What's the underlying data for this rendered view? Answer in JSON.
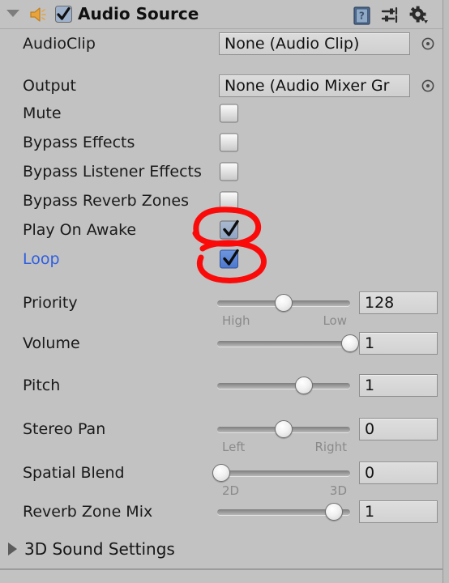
{
  "header": {
    "title": "Audio Source",
    "enabled_checkbox": true,
    "foldout_expanded": true,
    "icons": [
      {
        "name": "component-icon",
        "glyph": "speaker-icon"
      },
      {
        "name": "help-button",
        "glyph": "help-book-icon"
      },
      {
        "name": "preset-button",
        "glyph": "preset-sliders-icon"
      },
      {
        "name": "context-menu-button",
        "glyph": "gear-icon"
      }
    ]
  },
  "fields": {
    "audioclip": {
      "label": "AudioClip",
      "value": "None (Audio Clip)",
      "type": "object"
    },
    "output": {
      "label": "Output",
      "value": "None (Audio Mixer Gr",
      "type": "object"
    },
    "mute": {
      "label": "Mute",
      "checked": false
    },
    "bypass_effects": {
      "label": "Bypass Effects",
      "checked": false
    },
    "bypass_listener_effects": {
      "label": "Bypass Listener Effects",
      "checked": false
    },
    "bypass_reverb_zones": {
      "label": "Bypass Reverb Zones",
      "checked": false
    },
    "play_on_awake": {
      "label": "Play On Awake",
      "checked": true,
      "annotated": true
    },
    "loop": {
      "label": "Loop",
      "checked": true,
      "annotated": true,
      "highlighted": true
    },
    "priority": {
      "label": "Priority",
      "value": "128",
      "slider_pct": 50,
      "end_low": "High",
      "end_high": "Low"
    },
    "volume": {
      "label": "Volume",
      "value": "1",
      "slider_pct": 100,
      "end_low": "",
      "end_high": ""
    },
    "pitch": {
      "label": "Pitch",
      "value": "1",
      "slider_pct": 65,
      "end_low": "",
      "end_high": ""
    },
    "stereo_pan": {
      "label": "Stereo Pan",
      "value": "0",
      "slider_pct": 50,
      "end_low": "Left",
      "end_high": "Right"
    },
    "spatial_blend": {
      "label": "Spatial Blend",
      "value": "0",
      "slider_pct": 3,
      "end_low": "2D",
      "end_high": "3D"
    },
    "reverb_zone_mix": {
      "label": "Reverb Zone Mix",
      "value": "1",
      "slider_pct": 88,
      "end_low": "",
      "end_high": ""
    }
  },
  "sections": {
    "sound_3d": {
      "label": "3D Sound Settings",
      "expanded": false
    }
  },
  "colors": {
    "background": "#c2c2c2",
    "label_text": "#1a1a1a",
    "highlight_label": "#2f5fe0",
    "annotation": "#ff0000",
    "checkbox_checked": "#8fa4c4",
    "checkbox_focus": "#4d79cf",
    "speaker_icon": "#e8a33d"
  }
}
